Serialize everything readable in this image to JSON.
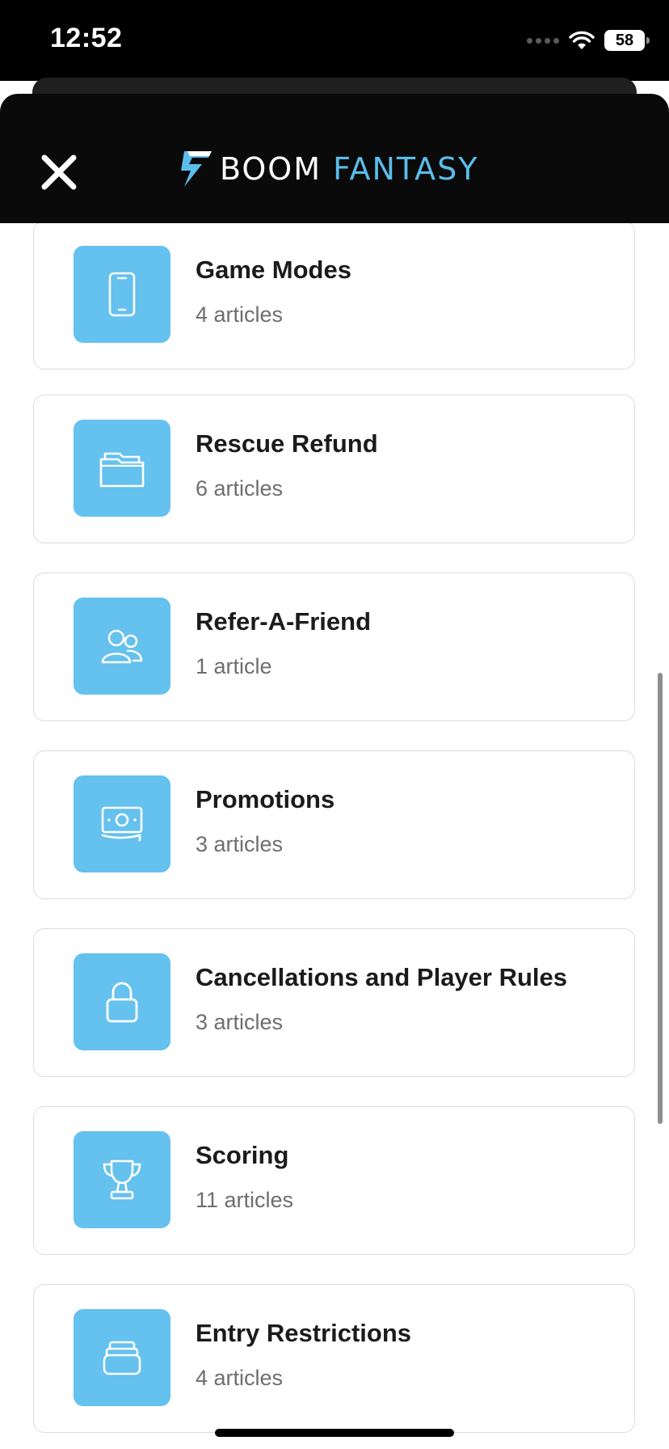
{
  "status_bar": {
    "time": "12:52",
    "battery": "58"
  },
  "header": {
    "brand_first": "BOOM",
    "brand_second": "FANTASY",
    "close_icon": "close-icon"
  },
  "colors": {
    "accent": "#65c1ee",
    "header_bg": "#0a0a0a"
  },
  "categories": [
    {
      "title": "Game Modes",
      "count": "4 articles",
      "icon": "phone-icon"
    },
    {
      "title": "Rescue Refund",
      "count": "6 articles",
      "icon": "folders-icon"
    },
    {
      "title": "Refer-A-Friend",
      "count": "1 article",
      "icon": "people-icon"
    },
    {
      "title": "Promotions",
      "count": "3 articles",
      "icon": "money-icon"
    },
    {
      "title": "Cancellations and Player Rules",
      "count": "3 articles",
      "icon": "lock-icon"
    },
    {
      "title": "Scoring",
      "count": "11 articles",
      "icon": "trophy-icon"
    },
    {
      "title": "Entry Restrictions",
      "count": "4 articles",
      "icon": "stack-icon"
    }
  ]
}
